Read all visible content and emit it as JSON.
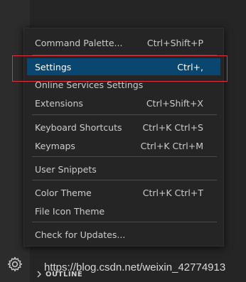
{
  "menu": {
    "items": [
      {
        "label": "Command Palette...",
        "shortcut": "Ctrl+Shift+P"
      },
      {
        "label": "Settings",
        "shortcut": "Ctrl+,"
      },
      {
        "label": "Online Services Settings",
        "shortcut": ""
      },
      {
        "label": "Extensions",
        "shortcut": "Ctrl+Shift+X"
      },
      {
        "label": "Keyboard Shortcuts",
        "shortcut": "Ctrl+K Ctrl+S"
      },
      {
        "label": "Keymaps",
        "shortcut": "Ctrl+K Ctrl+M"
      },
      {
        "label": "User Snippets",
        "shortcut": ""
      },
      {
        "label": "Color Theme",
        "shortcut": "Ctrl+K Ctrl+T"
      },
      {
        "label": "File Icon Theme",
        "shortcut": ""
      },
      {
        "label": "Check for Updates...",
        "shortcut": ""
      }
    ],
    "active_item": "Settings"
  },
  "panel": {
    "outline_label": "OUTLINE"
  },
  "watermark": "https://blog.csdn.net/weixin_42774913",
  "icons": {
    "manage": "gear-icon",
    "outline_toggle": "chevron-right-icon"
  },
  "colors": {
    "menu_background": "#252526",
    "selection": "#094771",
    "highlight_border": "#e0323e"
  }
}
